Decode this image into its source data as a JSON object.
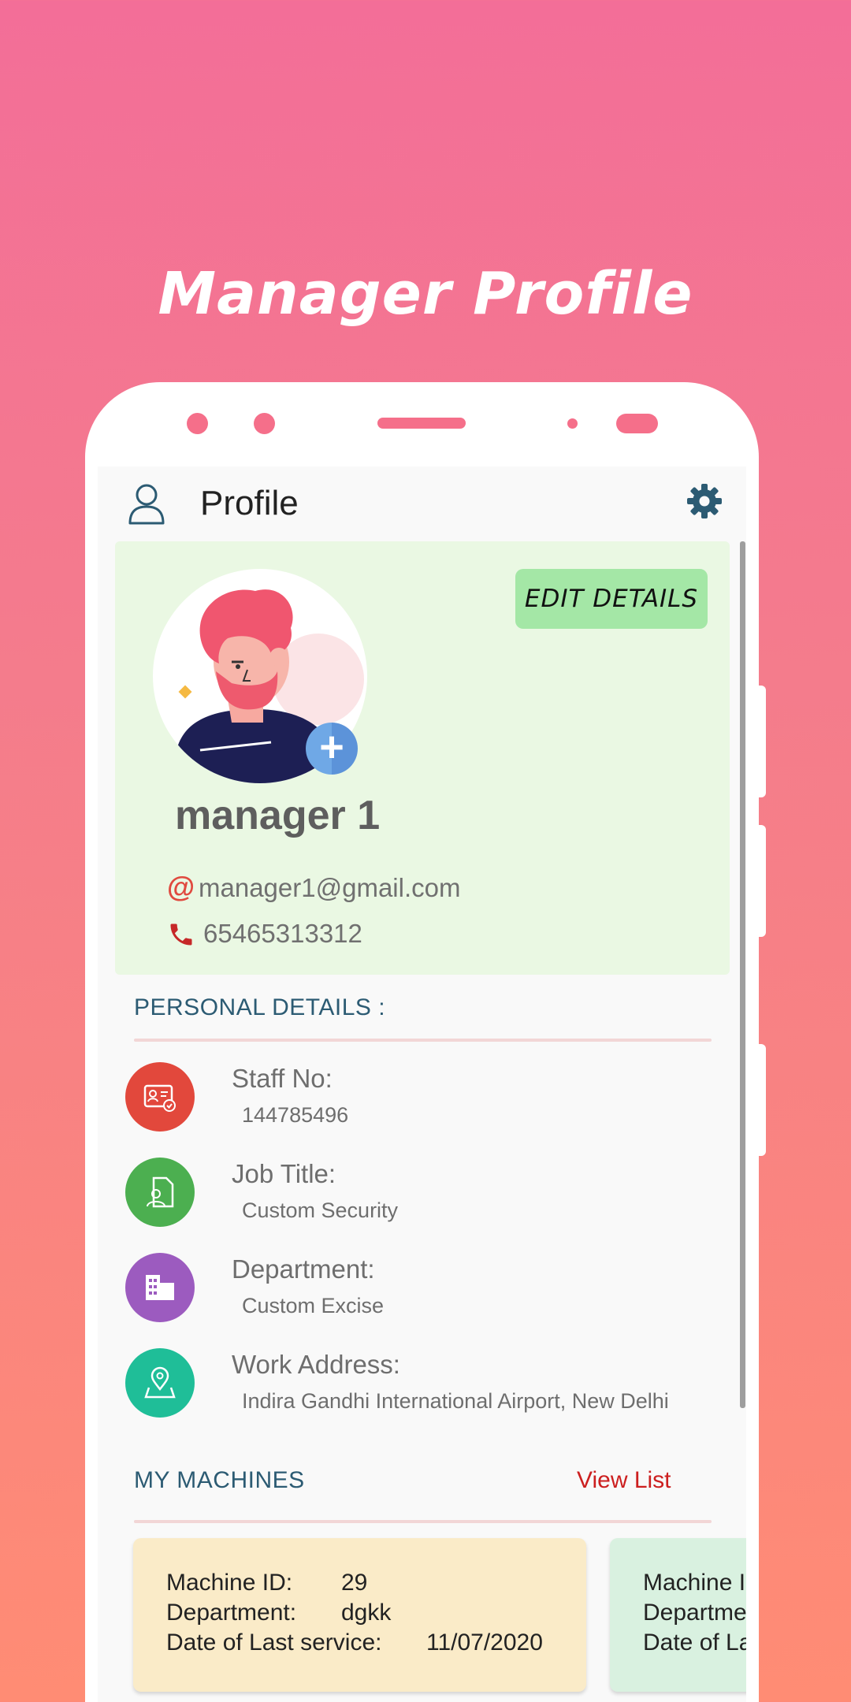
{
  "banner": {
    "title": "Manager Profile"
  },
  "appbar": {
    "title": "Profile"
  },
  "profile": {
    "edit_label": "EDIT DETAILS",
    "name": "manager 1",
    "email_symbol": "@",
    "email": "manager1@gmail.com",
    "phone": "65465313312"
  },
  "personal": {
    "header": "PERSONAL DETAILS :",
    "items": [
      {
        "label": "Staff No:",
        "value": "144785496",
        "icon": "id-card-icon",
        "color": "#E2483C"
      },
      {
        "label": "Job Title:",
        "value": "Custom Security",
        "icon": "worker-document-icon",
        "color": "#4CAF50"
      },
      {
        "label": "Department:",
        "value": "Custom Excise",
        "icon": "building-icon",
        "color": "#9C5BBF"
      },
      {
        "label": "Work Address:",
        "value": "Indira Gandhi International Airport, New Delhi",
        "icon": "map-pin-icon",
        "color": "#1FBE98"
      }
    ]
  },
  "machines": {
    "header": "MY MACHINES",
    "view_list": "View List",
    "cards": [
      {
        "id_label": "Machine ID:",
        "id": "29",
        "dept_label": "Department:",
        "dept": "dgkk",
        "date_label": "Date of Last service:",
        "date": "11/07/2020",
        "bg": "#FAEBC8"
      },
      {
        "id_label": "Machine ID:",
        "id": "",
        "dept_label": "Department:",
        "dept": "",
        "date_label": "Date of Last service:",
        "date": "",
        "bg": "#D9F1E0"
      }
    ]
  },
  "colors": {
    "accent_pink": "#F56F8A",
    "header_teal": "#2C5B73",
    "link_red": "#CC1F1F"
  }
}
